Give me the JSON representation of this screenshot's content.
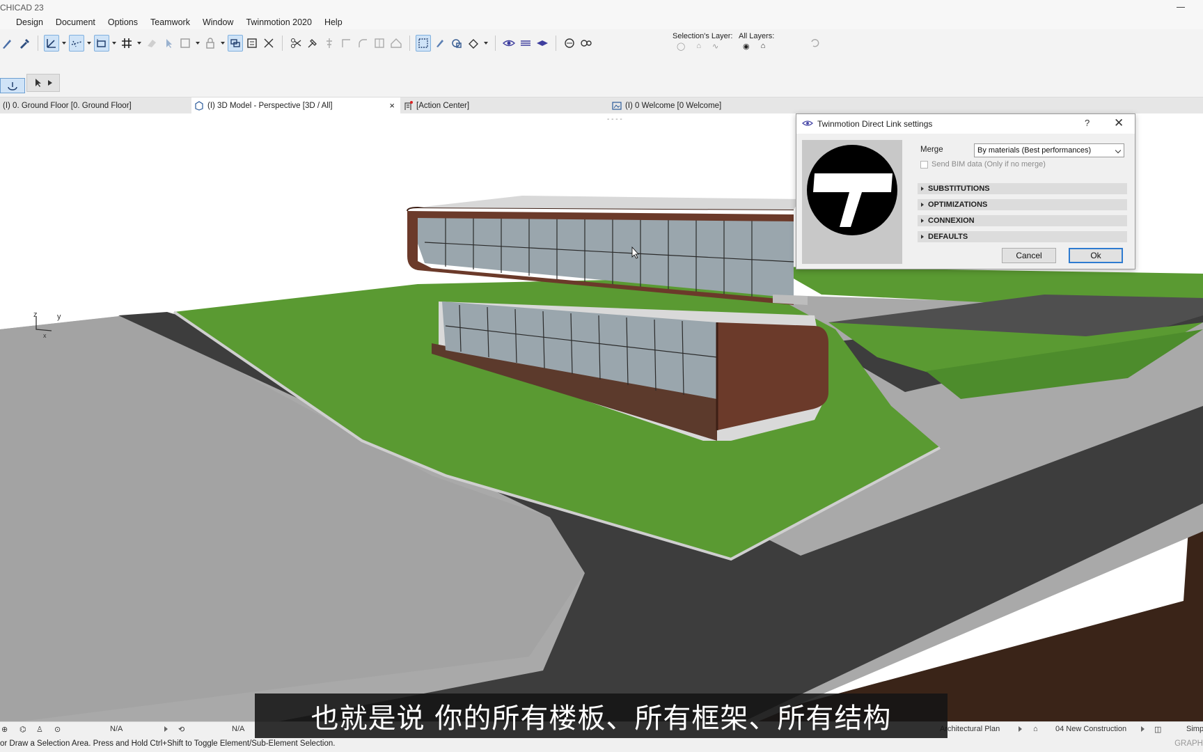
{
  "app": {
    "title": "CHICAD 23"
  },
  "menu": [
    "",
    "Design",
    "Document",
    "Options",
    "Teamwork",
    "Window",
    "Twinmotion 2020",
    "Help"
  ],
  "toolbar": {
    "selection_layer_label": "Selection's Layer:",
    "all_layers_label": "All Layers:"
  },
  "tabs": [
    {
      "label": "(I) 0. Ground Floor [0. Ground Floor]",
      "icon": "floor-plan-icon"
    },
    {
      "label": "(I) 3D Model - Perspective [3D / All]",
      "icon": "3d-cube-icon",
      "close": "×"
    },
    {
      "label": "[Action Center]",
      "icon": "action-center-icon"
    },
    {
      "label": "(I) 0 Welcome [0 Welcome]",
      "icon": "layout-icon"
    }
  ],
  "viewport": {
    "axis_z": "z",
    "axis_y": "y",
    "axis_x": "x",
    "tab_handle": "- - - -"
  },
  "dialog": {
    "title": "Twinmotion Direct Link settings",
    "help": "?",
    "close": "✕",
    "merge_label": "Merge",
    "merge_value": "By materials (Best performances)",
    "send_bim_label": "Send BIM data (Only if no merge)",
    "sections": [
      "SUBSTITUTIONS",
      "OPTIMIZATIONS",
      "CONNEXION",
      "DEFAULTS"
    ],
    "cancel_label": "Cancel",
    "ok_label": "Ok"
  },
  "subtitle": "也就是说 你的所有楼板、所有框架、所有结构",
  "statusbar": {
    "zoom_value_1": "N/A",
    "zoom_value_2": "N/A",
    "layer_combo": "Architectural Plan",
    "renovation_filter": "04 New Construction",
    "partial_structure": "Simp"
  },
  "infobar": {
    "hint": "or Draw a Selection Area. Press and Hold Ctrl+Shift to Toggle Element/Sub-Element Selection.",
    "graphisoft": "GRAPH"
  },
  "colors": {
    "accent": "#2e7bd0",
    "active_tool_bg": "#cfe3f7",
    "grass": "#5a9a32",
    "road": "#3c3c3c",
    "building_brick": "#6b3a2a"
  }
}
